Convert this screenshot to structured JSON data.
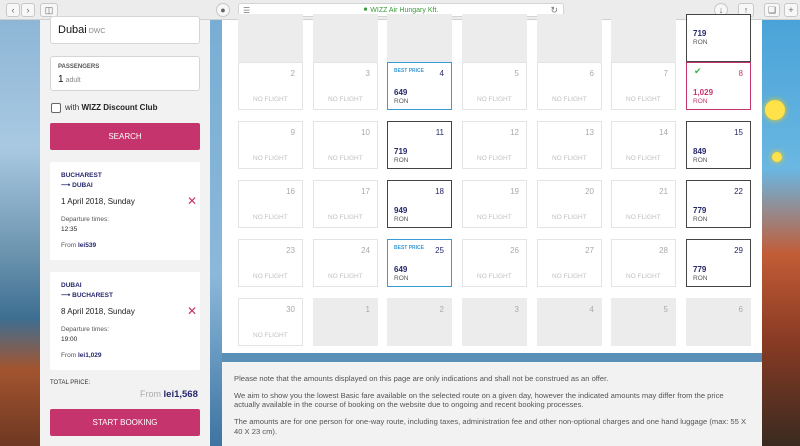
{
  "browser": {
    "url_text": "WIZZ Air Hungary Kft."
  },
  "sidebar": {
    "destination": {
      "city": "Dubai",
      "code": "DWC"
    },
    "passengers": {
      "label": "PASSENGERS",
      "count": "1",
      "unit": "adult"
    },
    "discount_club": {
      "prefix": "with",
      "name": "WIZZ Discount Club"
    },
    "search_label": "SEARCH",
    "trips": [
      {
        "from": "BUCHAREST",
        "to": "⟶ DUBAI",
        "date": "1 April 2018, Sunday",
        "departure_label": "Departure times:",
        "time": "12:35",
        "price_prefix": "From",
        "price": "lei539"
      },
      {
        "from": "DUBAI",
        "to": "⟶ BUCHAREST",
        "date": "8 April 2018, Sunday",
        "departure_label": "Departure times:",
        "time": "19:00",
        "price_prefix": "From",
        "price": "lei1,029"
      }
    ],
    "total_label": "TOTAL PRICE:",
    "total_prefix": "From",
    "total_value": "lei1,568",
    "start_booking_label": "START BOOKING"
  },
  "calendar": {
    "no_flight_label": "NO FLIGHT",
    "best_price_label": "BEST PRICE",
    "top_partial": [
      {
        "fare": "719",
        "currency": "RON"
      }
    ],
    "rows": [
      [
        {
          "day": "2"
        },
        {
          "day": "3"
        },
        {
          "day": "4",
          "fare": "649",
          "currency": "RON",
          "best": true
        },
        {
          "day": "5"
        },
        {
          "day": "6"
        },
        {
          "day": "7"
        },
        {
          "day": "8",
          "fare": "1,029",
          "currency": "RON",
          "selected": true
        }
      ],
      [
        {
          "day": "9"
        },
        {
          "day": "10"
        },
        {
          "day": "11",
          "fare": "719",
          "currency": "RON"
        },
        {
          "day": "12"
        },
        {
          "day": "13"
        },
        {
          "day": "14"
        },
        {
          "day": "15",
          "fare": "849",
          "currency": "RON"
        }
      ],
      [
        {
          "day": "16"
        },
        {
          "day": "17"
        },
        {
          "day": "18",
          "fare": "949",
          "currency": "RON"
        },
        {
          "day": "19"
        },
        {
          "day": "20"
        },
        {
          "day": "21"
        },
        {
          "day": "22",
          "fare": "779",
          "currency": "RON"
        }
      ],
      [
        {
          "day": "23"
        },
        {
          "day": "24"
        },
        {
          "day": "25",
          "fare": "649",
          "currency": "RON",
          "best": true
        },
        {
          "day": "26"
        },
        {
          "day": "27"
        },
        {
          "day": "28"
        },
        {
          "day": "29",
          "fare": "779",
          "currency": "RON"
        }
      ],
      [
        {
          "day": "30"
        },
        {
          "day": "1",
          "other": true
        },
        {
          "day": "2",
          "other": true
        },
        {
          "day": "3",
          "other": true
        },
        {
          "day": "4",
          "other": true
        },
        {
          "day": "5",
          "other": true
        },
        {
          "day": "6",
          "other": true
        }
      ]
    ]
  },
  "notes": {
    "p1": "Please note that the amounts displayed on this page are only indications and shall not be construed as an offer.",
    "p2": "We aim to show you the lowest Basic fare available on the selected route on a given day, however the indicated amounts may differ from the price actually available in the course of booking on the website due to ongoing and recent booking processes.",
    "p3": "The amounts are for one person for one-way route, including taxes, administration fee and other non-optional charges and one hand luggage (max: 55 X 40 X 23 cm)."
  },
  "colors": {
    "brand_pink": "#c6346d",
    "brand_navy": "#25276b",
    "best_price_blue": "#3a9ad5",
    "tick_green": "#2fb54a"
  }
}
